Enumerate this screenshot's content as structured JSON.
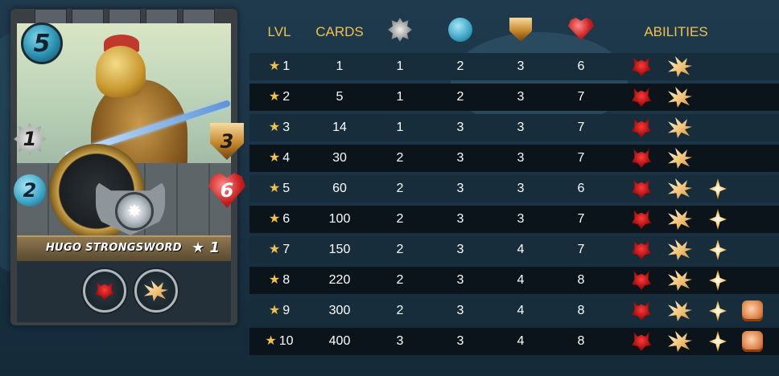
{
  "card": {
    "name": "HUGO STRONGSWORD",
    "mana": "5",
    "melee": "1",
    "ranged": "2",
    "armor": "3",
    "health": "6",
    "level_label": "★ 1",
    "abilities": [
      "enrage-icon",
      "shatter-icon"
    ]
  },
  "table": {
    "headers": {
      "lvl": "LVL",
      "cards": "CARDS",
      "melee_icon": "melee-attack-icon",
      "ranged_icon": "ranged-attack-icon",
      "armor_icon": "armor-icon",
      "health_icon": "health-icon",
      "abilities": "ABILITIES"
    },
    "rows": [
      {
        "star": "★",
        "lvl": "1",
        "cards": "1",
        "melee": "1",
        "ranged": "2",
        "armor": "3",
        "health": "6",
        "abilities": [
          "enrage-icon",
          "shatter-icon"
        ]
      },
      {
        "star": "★",
        "lvl": "2",
        "cards": "5",
        "melee": "1",
        "ranged": "2",
        "armor": "3",
        "health": "7",
        "abilities": [
          "enrage-icon",
          "shatter-icon"
        ]
      },
      {
        "star": "★",
        "lvl": "3",
        "cards": "14",
        "melee": "1",
        "ranged": "3",
        "armor": "3",
        "health": "7",
        "abilities": [
          "enrage-icon",
          "shatter-icon"
        ]
      },
      {
        "star": "★",
        "lvl": "4",
        "cards": "30",
        "melee": "2",
        "ranged": "3",
        "armor": "3",
        "health": "7",
        "abilities": [
          "enrage-icon",
          "shatter-icon"
        ]
      },
      {
        "star": "★",
        "lvl": "5",
        "cards": "60",
        "melee": "2",
        "ranged": "3",
        "armor": "3",
        "health": "6",
        "abilities": [
          "enrage-icon",
          "shatter-icon",
          "sparkle-icon"
        ]
      },
      {
        "star": "★",
        "lvl": "6",
        "cards": "100",
        "melee": "2",
        "ranged": "3",
        "armor": "3",
        "health": "7",
        "abilities": [
          "enrage-icon",
          "shatter-icon",
          "sparkle-icon"
        ]
      },
      {
        "star": "★",
        "lvl": "7",
        "cards": "150",
        "melee": "2",
        "ranged": "3",
        "armor": "4",
        "health": "7",
        "abilities": [
          "enrage-icon",
          "shatter-icon",
          "sparkle-icon"
        ]
      },
      {
        "star": "★",
        "lvl": "8",
        "cards": "220",
        "melee": "2",
        "ranged": "3",
        "armor": "4",
        "health": "8",
        "abilities": [
          "enrage-icon",
          "shatter-icon",
          "sparkle-icon"
        ]
      },
      {
        "star": "★",
        "lvl": "9",
        "cards": "300",
        "melee": "2",
        "ranged": "3",
        "armor": "4",
        "health": "8",
        "abilities": [
          "enrage-icon",
          "shatter-icon",
          "sparkle-icon",
          "fist-icon"
        ]
      },
      {
        "star": "★",
        "lvl": "10",
        "cards": "400",
        "melee": "3",
        "ranged": "3",
        "armor": "4",
        "health": "8",
        "abilities": [
          "enrage-icon",
          "shatter-icon",
          "sparkle-icon",
          "fist-icon"
        ]
      }
    ]
  },
  "colors": {
    "header_gold": "#f2c14a",
    "row_odd": "#172d3c",
    "row_even": "#0b141b",
    "background": "#1f3a4d"
  }
}
